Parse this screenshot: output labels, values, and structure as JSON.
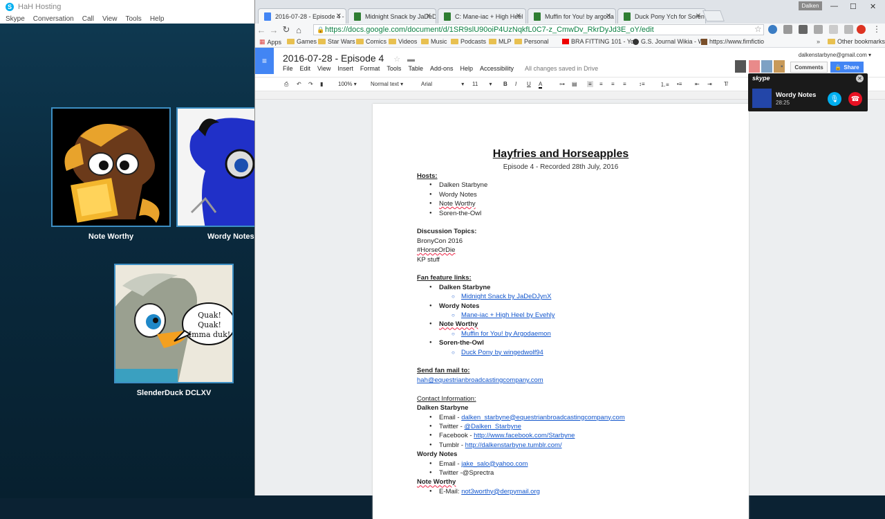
{
  "skype": {
    "title": "HaH Hosting",
    "menu": [
      "Skype",
      "Conversation",
      "Call",
      "View",
      "Tools",
      "Help"
    ],
    "participants": [
      "Note Worthy",
      "Wordy Notes",
      "SlenderDuck DCLXV"
    ],
    "speech_bubble": "Quak! Quak! Imma duk!"
  },
  "chrome": {
    "user_badge": "Dalken",
    "tabs": [
      {
        "label": "2016-07-28 - Episode 4 -",
        "color": "#4285f4"
      },
      {
        "label": "Midnight Snack by JaDeD",
        "color": "#2e7d32"
      },
      {
        "label": "C: Mane-iac + High Heel",
        "color": "#2e7d32"
      },
      {
        "label": "Muffin for You! by argoda",
        "color": "#2e7d32"
      },
      {
        "label": "Duck Pony Ych for Soren",
        "color": "#2e7d32"
      }
    ],
    "url": "https://docs.google.com/document/d/1SR9slU90oiP4UzNqkfL0C7-z_CmwDv_RkrDyJd3E_oY/edit",
    "bookmarks": [
      "Apps",
      "Games",
      "Star Wars",
      "Comics",
      "Videos",
      "Music",
      "Podcasts",
      "MLP",
      "Personal",
      "BRA FITTING 101 - Yo",
      "G.S. Journal Wikia - W",
      "https://www.fimfictio",
      "Other bookmarks"
    ]
  },
  "docs": {
    "title": "2016-07-28 - Episode 4",
    "menu": [
      "File",
      "Edit",
      "View",
      "Insert",
      "Format",
      "Tools",
      "Table",
      "Add-ons",
      "Help",
      "Accessibility"
    ],
    "saved": "All changes saved in Drive",
    "email": "dalkenstarbyne@gmail.com",
    "comments": "Comments",
    "share": "Share",
    "toolbar": {
      "zoom": "100%",
      "style": "Normal text",
      "font": "Arial",
      "size": "11"
    }
  },
  "document": {
    "heading": "Hayfries and Horseapples",
    "subheading": "Episode 4 - Recorded 28th July, 2016",
    "hosts_label": "Hosts:",
    "hosts": [
      "Dalken Starbyne",
      "Wordy Notes",
      "Note Worthy",
      "Soren-the-Owl"
    ],
    "topics_label": "Discussion Topics:",
    "topics": [
      "BronyCon 2016",
      "#HorseOrDie",
      "KP stuff"
    ],
    "fan_label": "Fan feature links:",
    "fan": [
      {
        "host": "Dalken Starbyne",
        "link": "Midnight Snack by JaDeDJynX"
      },
      {
        "host": "Wordy Notes",
        "link": "Mane-iac + High Heel by Evehly"
      },
      {
        "host": "Note Worthy",
        "link": "Muffin for You! by Argodaemon"
      },
      {
        "host": "Soren-the-Owl",
        "link": "Duck Pony by wingedwolf94"
      }
    ],
    "mail_label": "Send fan mail to:",
    "mail": "hah@equestrianbroadcastingcompany.com",
    "contact_label": "Contact Information:",
    "dalken": "Dalken Starbyne",
    "dalken_email_label": "Email - ",
    "dalken_email": "dalken_starbyne@equestrianbroadcastingcompany.com",
    "dalken_twitter_label": "Twitter - ",
    "dalken_twitter": "@Dalken_Starbyne",
    "dalken_fb_label": "Facebook - ",
    "dalken_fb": "http://www.facebook.com/Starbyne",
    "dalken_tumblr_label": "Tumblr - ",
    "dalken_tumblr": "http://dalkenstarbyne.tumblr.com/",
    "wordy": "Wordy Notes",
    "wordy_email_label": "Email - ",
    "wordy_email": "jake_salo@yahoo.com",
    "wordy_twitter": "Twitter -@Sprectra",
    "note": "Note Worthy",
    "note_email_label": "E-Mail: ",
    "note_email": "not3worthy@derpymail.org"
  },
  "call": {
    "app": "skype",
    "name": "Wordy Notes",
    "time": "28:25"
  }
}
